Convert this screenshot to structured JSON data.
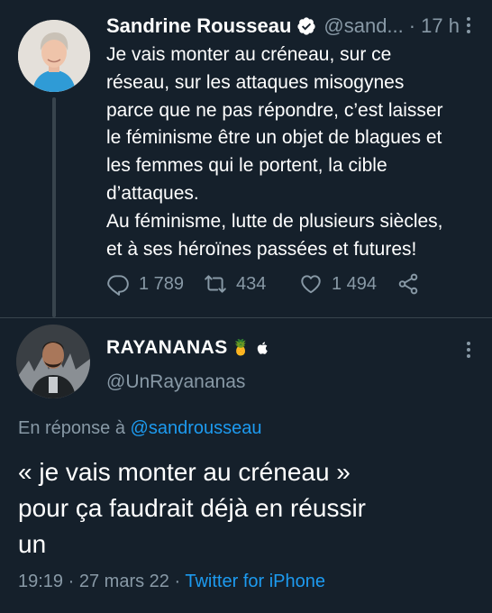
{
  "tweet1": {
    "author_name": "Sandrine Rousseau",
    "author_handle": "@sand...",
    "separator": "·",
    "time": "17 h",
    "text_lines": [
      "Je vais monter au créneau, sur ce",
      "réseau, sur les attaques misogynes",
      "parce que ne pas répondre, c’est laisser",
      "le féminisme être un objet de blagues et",
      "les femmes qui le portent, la cible",
      "d’attaques.",
      "Au féminisme, lutte de plusieurs siècles,",
      "et à ses héroïnes passées et futures!"
    ],
    "actions": {
      "reply_count": "1 789",
      "retweet_count": "434",
      "like_count": "1 494"
    },
    "icons": [
      "verified-badge-icon",
      "more-icon",
      "reply-icon",
      "retweet-icon",
      "like-icon",
      "share-icon"
    ]
  },
  "tweet2": {
    "author_name": "RAYANANAS",
    "author_emoji": "🍍",
    "author_handle": "@UnRayananas",
    "reply_label": "En réponse à",
    "reply_mention": "@sandrousseau",
    "text_lines": [
      "«  je vais monter au créneau »",
      "pour ça faudrait déjà en réussir",
      "un"
    ],
    "time": "19:19",
    "date": "27 mars 22",
    "separator": "·",
    "source": "Twitter for iPhone",
    "icons": [
      "apple-icon",
      "more-icon"
    ]
  },
  "colors": {
    "background": "#15202b",
    "secondary_text": "#8899a6",
    "link": "#1d9bf0",
    "divider": "#38444d"
  }
}
